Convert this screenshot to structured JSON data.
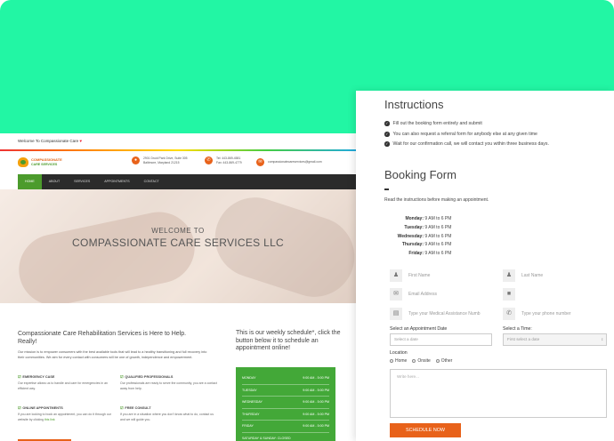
{
  "site": {
    "welcome_bar": "Welcome To Compassionate Care",
    "logo_line1": "COMPASSIONATE",
    "logo_line2": "CARE SERVICES",
    "address_line1": "2901 Druid Park Drive, Suite 305",
    "address_line2": "Baltimore, Maryland 21215",
    "phone_line1": "Tel: 443-869-4581",
    "phone_line2": "Fax: 443-869-4779",
    "email": "compassionatecareservices@gmail.com",
    "nav": [
      "HOME",
      "ABOUT",
      "SERVICES",
      "APPOINTMENTS",
      "CONTACT"
    ],
    "hero_line1": "WELCOME TO",
    "hero_line2": "COMPASSIONATE CARE SERVICES LLC",
    "section_title": "Compassionate Care Rehabilitation Services is Here to Help. Really!",
    "mission": "Our mission is to empower consumers with the best available tools that will lead to a healthy transitioning and full recovery into their communities. We aim for every contact with consumers will be one of growth, independence and empowerment.",
    "features": [
      {
        "title": "EMERGENCY CASE",
        "desc": "Our expertise allows us to handle and care for emergencies in an efficient way."
      },
      {
        "title": "QUALIFIED PROFESSIONALS",
        "desc": "Our professionals are ready to serve the community, you are a contact away from help."
      },
      {
        "title": "ONLINE APPOINTMENTS",
        "desc": "If you are looking to book an appointment, you can do it through our website by clicking",
        "link": "this link"
      },
      {
        "title": "FREE CONSULT",
        "desc": "If you are in a situation where you don't know what to do, contact us and we will guide you."
      }
    ],
    "schedule_title": "This is our weekly schedule*, click the button below it to schedule an appointment online!",
    "schedule": [
      {
        "day": "MONDAY",
        "time": "9:00 AM - 5:00 PM"
      },
      {
        "day": "TUESDAY",
        "time": "9:00 AM - 5:00 PM"
      },
      {
        "day": "WEDNESDAY",
        "time": "9:00 AM - 5:00 PM"
      },
      {
        "day": "THURSDAY",
        "time": "9:00 AM - 5:00 PM"
      },
      {
        "day": "FRIDAY",
        "time": "9:00 AM - 5:00 PM"
      },
      {
        "day": "SATURDAY & SUNDAY: CLOSED",
        "time": ""
      }
    ]
  },
  "form": {
    "instructions_heading": "Instructions",
    "instructions": [
      "Fill out the booking form entirely and submit",
      "You can also request a referral form for anybody else at any given time",
      "Wait for our confirmation call, we will contact you within three business days."
    ],
    "booking_heading": "Booking Form",
    "read_note": "Read the instructions before making an appointment.",
    "hours": [
      {
        "day": "Monday:",
        "time": "9 AM to 6 PM"
      },
      {
        "day": "Tuesday:",
        "time": "9 AM to 6 PM"
      },
      {
        "day": "Wednesday:",
        "time": "9 AM to 6 PM"
      },
      {
        "day": "Thursday:",
        "time": "9 AM to 6 PM"
      },
      {
        "day": "Friday:",
        "time": "9 AM to 6 PM"
      }
    ],
    "first_name_placeholder": "First Name",
    "last_name_placeholder": "Last Name",
    "email_placeholder": "Email Address",
    "ma_placeholder": "Type your Medical Assistance Numb",
    "phone_placeholder": "Type your phone number",
    "date_label": "Select an Appointment Date",
    "date_placeholder": "Select a date",
    "time_label": "Select a Time:",
    "time_value": "First select a date",
    "location_label": "Location",
    "location_options": [
      "Home",
      "Onsite",
      "Other"
    ],
    "message_placeholder": "Write here...",
    "submit_label": "SCHEDULE NOW"
  },
  "colors": {
    "banner": "#22f6a4",
    "brand_green": "#4c9b2c",
    "brand_orange": "#e8621a",
    "schedule_green": "#43a838"
  }
}
